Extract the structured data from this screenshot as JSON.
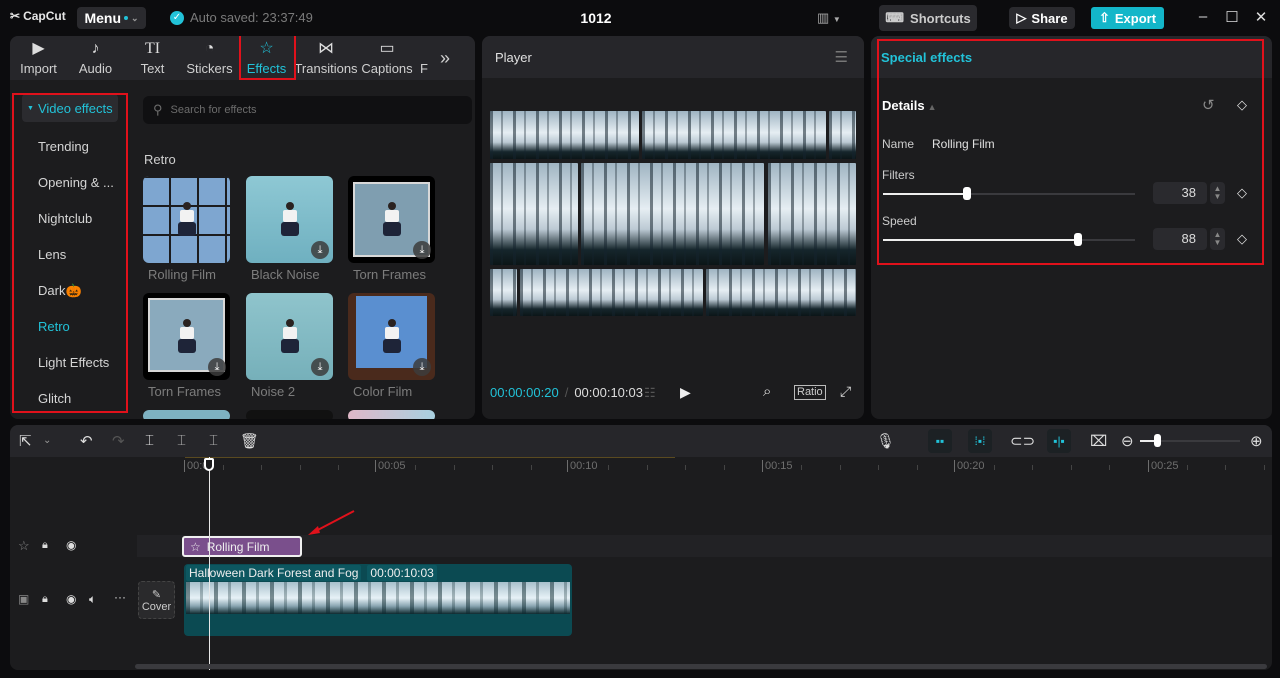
{
  "app": {
    "name": "CapCut",
    "menu_label": "Menu",
    "autosave": "Auto saved: 23:37:49",
    "project_title": "1012"
  },
  "topbar": {
    "shortcuts": "Shortcuts",
    "share": "Share",
    "export": "Export"
  },
  "media_tabs": [
    {
      "label": "Import",
      "icon": "import-icon"
    },
    {
      "label": "Audio",
      "icon": "audio-icon"
    },
    {
      "label": "Text",
      "icon": "text-icon"
    },
    {
      "label": "Stickers",
      "icon": "stickers-icon"
    },
    {
      "label": "Effects",
      "icon": "effects-icon",
      "active": true
    },
    {
      "label": "Transitions",
      "icon": "transitions-icon"
    },
    {
      "label": "Captions",
      "icon": "captions-icon"
    },
    {
      "label": "F",
      "icon": ""
    }
  ],
  "sidebar": {
    "header": "Video effects",
    "items": [
      {
        "label": "Trending"
      },
      {
        "label": "Opening & ..."
      },
      {
        "label": "Nightclub"
      },
      {
        "label": "Lens"
      },
      {
        "label": "Dark🎃"
      },
      {
        "label": "Retro",
        "active": true
      },
      {
        "label": "Light Effects"
      },
      {
        "label": "Glitch"
      }
    ]
  },
  "effects": {
    "search_placeholder": "Search for effects",
    "section_title": "Retro",
    "items": [
      {
        "label": "Rolling Film",
        "download": false
      },
      {
        "label": "Black Noise",
        "download": true
      },
      {
        "label": "Torn Frames",
        "download": true
      },
      {
        "label": "Torn Frames",
        "download": true
      },
      {
        "label": "Noise 2",
        "download": true
      },
      {
        "label": "Color Film",
        "download": true
      }
    ]
  },
  "player": {
    "title": "Player",
    "current_time": "00:00:00:20",
    "total_time": "00:00:10:03",
    "ratio_label": "Ratio"
  },
  "special_effects": {
    "title": "Special effects",
    "details_label": "Details",
    "name_label": "Name",
    "name_value": "Rolling Film",
    "params": [
      {
        "label": "Filters",
        "value": "38",
        "percent": 38
      },
      {
        "label": "Speed",
        "value": "88",
        "percent": 88
      }
    ]
  },
  "timeline": {
    "ruler": [
      "00:00",
      "00:05",
      "00:10",
      "00:15",
      "00:20",
      "00:25"
    ],
    "effect_clip": "Rolling Film",
    "video_clip": {
      "title": "Halloween Dark Forest and Fog",
      "duration": "00:00:10:03"
    },
    "cover_label": "Cover"
  },
  "colors": {
    "accent": "#22c2d8",
    "effect_clip": "#7a4f8c",
    "video_clip": "#0b4a52",
    "highlight": "#e0111b"
  }
}
